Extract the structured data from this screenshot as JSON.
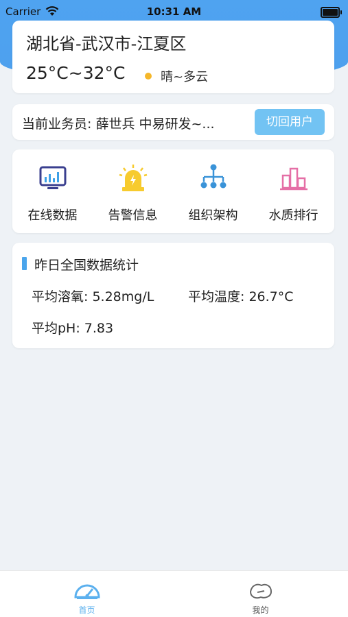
{
  "status_bar": {
    "carrier": "Carrier",
    "time": "10:31 AM"
  },
  "weather": {
    "location": "湖北省-武汉市-江夏区",
    "temperature": "25°C~32°C",
    "condition": "晴~多云"
  },
  "salesperson": {
    "text": "当前业务员: 薛世兵  中易研发~...",
    "switch_button": "切回用户"
  },
  "menu": {
    "items": [
      {
        "label": "在线数据",
        "icon": "monitor-chart-icon"
      },
      {
        "label": "告警信息",
        "icon": "alarm-light-icon"
      },
      {
        "label": "组织架构",
        "icon": "org-tree-icon"
      },
      {
        "label": "水质排行",
        "icon": "ranking-bars-icon"
      }
    ]
  },
  "stats": {
    "title": "昨日全国数据统计",
    "oxygen": "平均溶氧: 5.28mg/L",
    "temperature": "平均温度: 26.7°C",
    "ph": "平均pH: 7.83"
  },
  "tabbar": {
    "tabs": [
      {
        "label": "首页",
        "active": true,
        "icon": "home-dashboard-icon"
      },
      {
        "label": "我的",
        "active": false,
        "icon": "profile-icon"
      }
    ]
  },
  "colors": {
    "header_blue": "#4fa3f0",
    "button_blue": "#72c3f3",
    "accent_blue": "#4aa5ec",
    "weather_dot": "#f5b72a",
    "tab_active": "#5bb0ee",
    "tab_inactive": "#555555"
  }
}
